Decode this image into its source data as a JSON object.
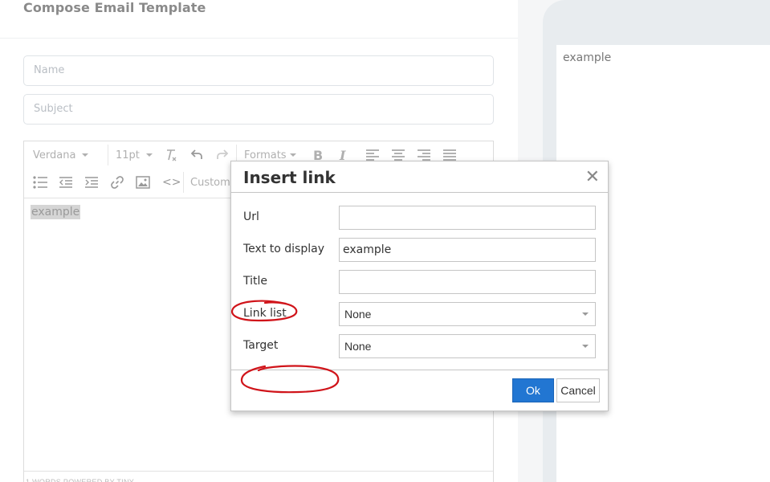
{
  "page": {
    "title": "Compose Email Template",
    "name_placeholder": "Name",
    "subject_placeholder": "Subject"
  },
  "editor": {
    "font_family": "Verdana",
    "font_size": "11pt",
    "formats_label": "Formats",
    "custom_label": "Custom",
    "content": "example",
    "statusbar": "1 WORDS POWERED BY TINY"
  },
  "preview": {
    "content": "example"
  },
  "dialog": {
    "title": "Insert link",
    "close_glyph": "✕",
    "url_label": "Url",
    "url_value": "",
    "text_label": "Text to display",
    "text_value": "example",
    "title_label": "Title",
    "title_value": "",
    "link_list_label": "Link list",
    "link_list_value": "None",
    "target_label": "Target",
    "target_value": "None",
    "ok_label": "Ok",
    "cancel_label": "Cancel"
  },
  "colors": {
    "primary_button": "#2276d2",
    "annotation": "#d0141a"
  }
}
